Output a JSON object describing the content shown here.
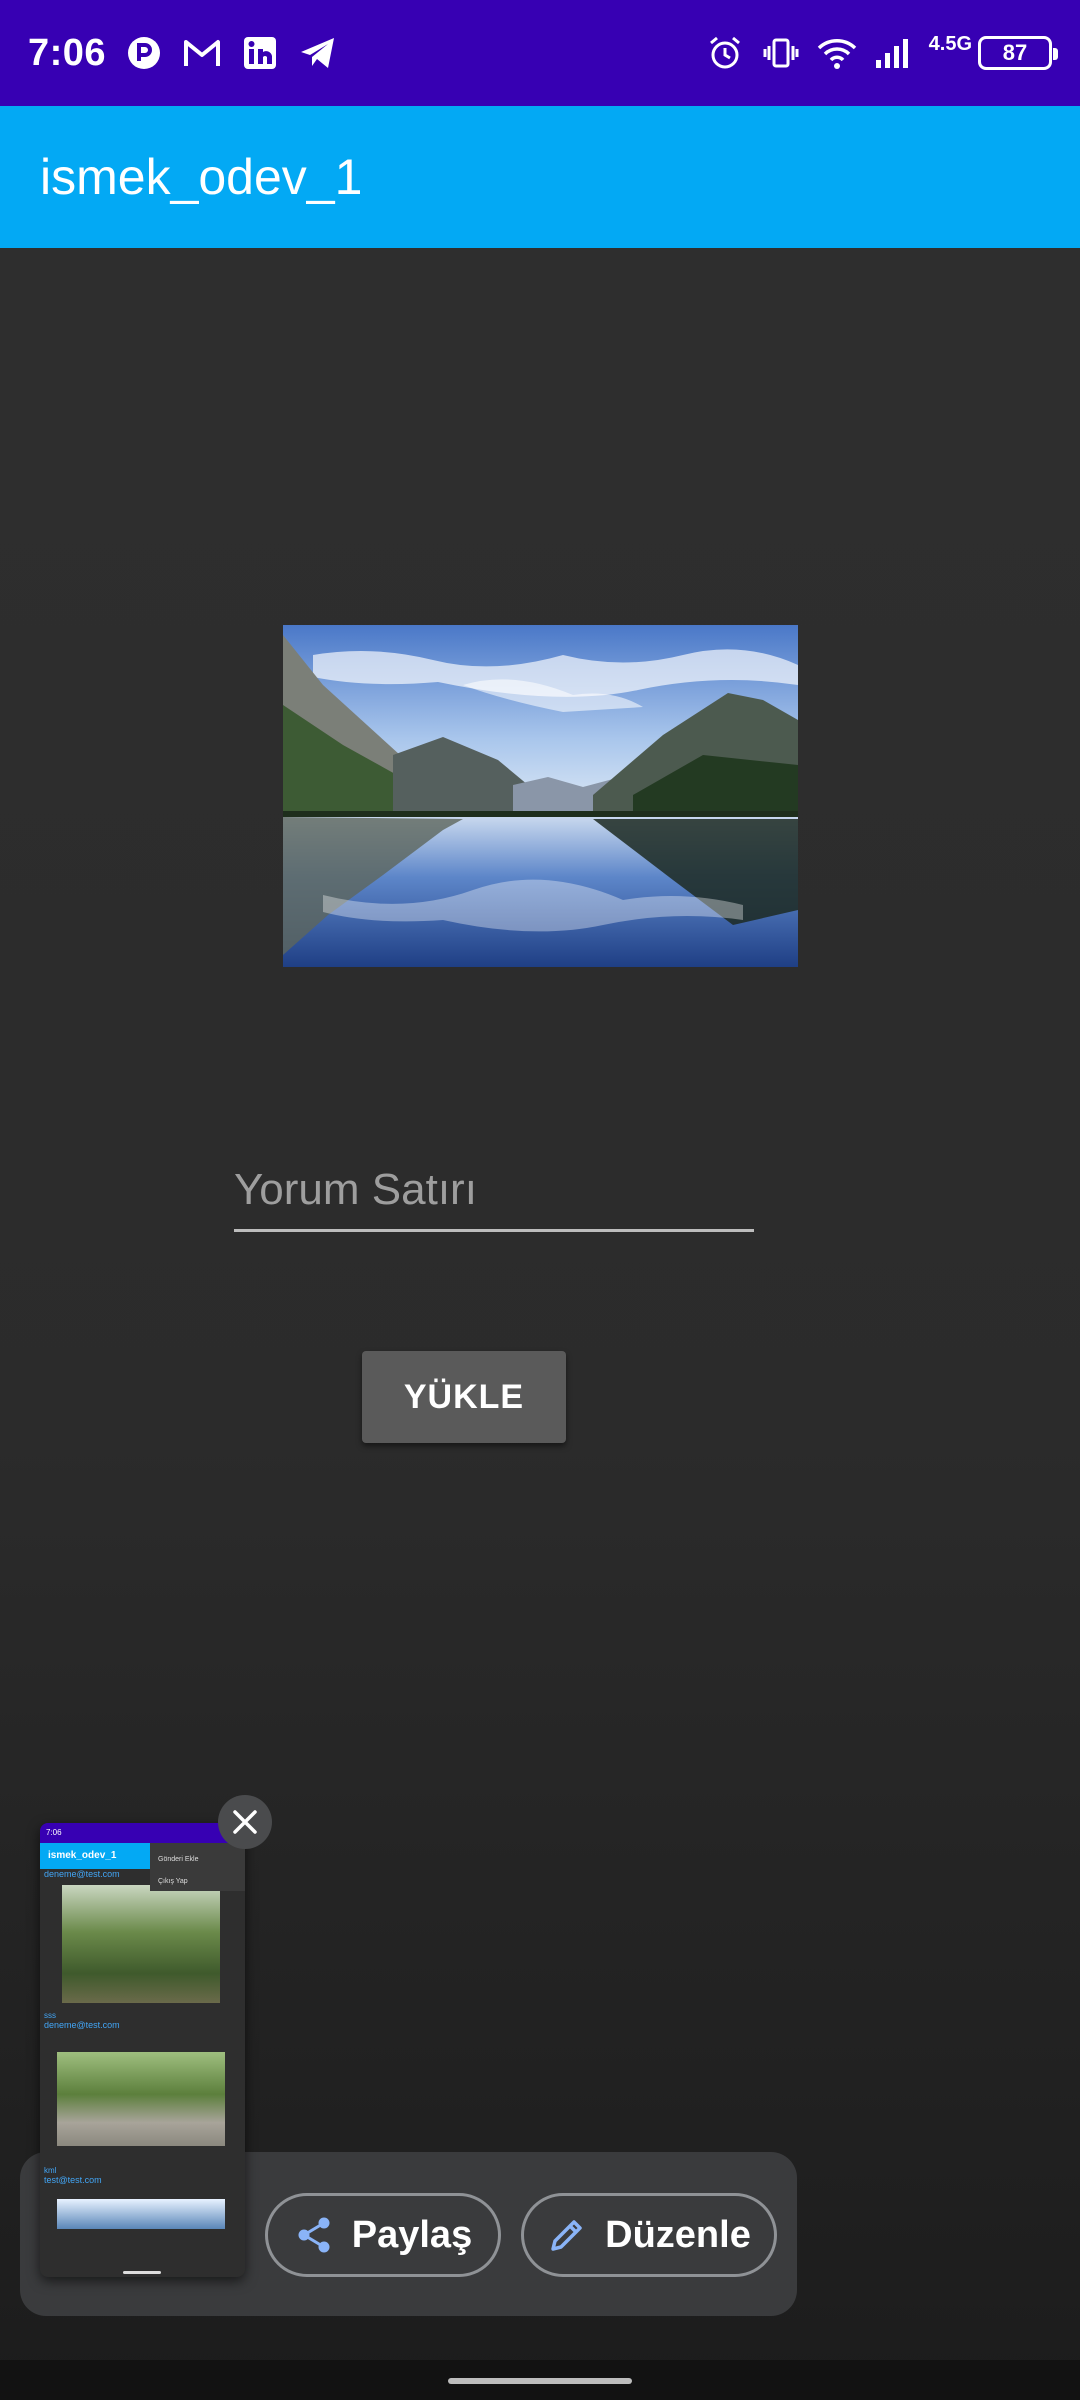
{
  "status_bar": {
    "time": "7:06",
    "network": "4.5G",
    "battery": "87",
    "left_icons": [
      "app-notification-icon",
      "gmail-icon",
      "linkedin-icon",
      "telegram-icon"
    ],
    "right_icons": [
      "alarm-icon",
      "vibrate-icon",
      "wifi-icon",
      "signal-icon",
      "battery-icon"
    ]
  },
  "app_bar": {
    "title": "ismek_odev_1"
  },
  "main": {
    "image_alt": "mountain-lake-photo",
    "comment_placeholder": "Yorum Satırı",
    "upload_label": "YÜKLE"
  },
  "screenshot_preview": {
    "thumbnail": {
      "time": "7:06",
      "app_title": "ismek_odev_1",
      "menu_items": [
        "Gönderi Ekle",
        "Çıkış Yap"
      ],
      "posts": [
        {
          "email": "deneme@test.com",
          "comment": ""
        },
        {
          "email": "deneme@test.com",
          "comment": "sss"
        },
        {
          "email": "test@test.com",
          "comment": "kml"
        }
      ]
    },
    "share_label": "Paylaş",
    "edit_label": "Düzenle"
  },
  "colors": {
    "status_bar": "#3700b3",
    "app_bar": "#03a9f4",
    "background": "#2f2f2f",
    "button": "#5a5a5a",
    "accent_icon": "#8ab4f8"
  }
}
